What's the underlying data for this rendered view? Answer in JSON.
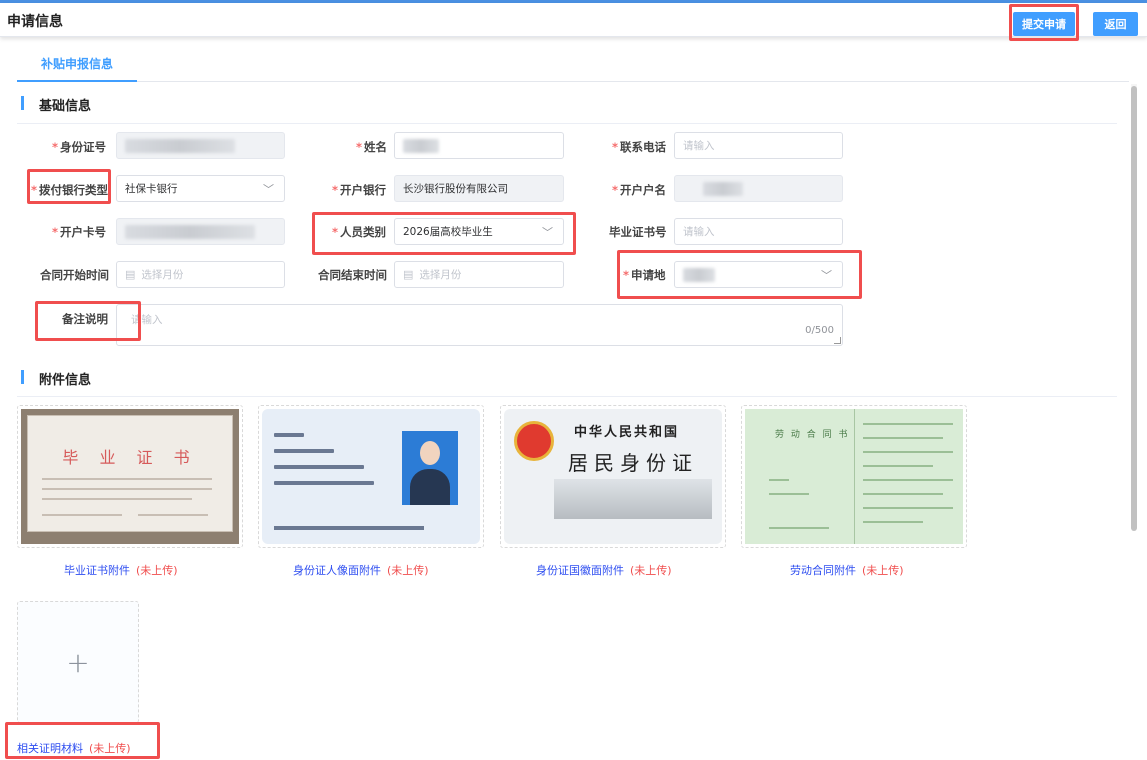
{
  "header": {
    "title": "申请信息",
    "submit_label": "提交申请",
    "back_label": "返回"
  },
  "tabs": [
    {
      "label": "补贴申报信息",
      "active": true
    }
  ],
  "sections": {
    "basic": "基础信息",
    "attachments": "附件信息"
  },
  "form": {
    "id_number": {
      "label": "身份证号",
      "required": true,
      "value": ""
    },
    "name": {
      "label": "姓名",
      "required": true,
      "value": ""
    },
    "phone": {
      "label": "联系电话",
      "required": true,
      "placeholder": "请输入"
    },
    "bank_type": {
      "label": "拨付银行类型",
      "required": true,
      "value": "社保卡银行"
    },
    "open_bank": {
      "label": "开户银行",
      "required": true,
      "value": "长沙银行股份有限公司"
    },
    "account_name": {
      "label": "开户户名",
      "required": true,
      "value": ""
    },
    "card_number": {
      "label": "开户卡号",
      "required": true,
      "value": ""
    },
    "person_type": {
      "label": "人员类别",
      "required": true,
      "value": "2026届高校毕业生"
    },
    "cert_number": {
      "label": "毕业证书号",
      "required": false,
      "placeholder": "请输入"
    },
    "contract_start": {
      "label": "合同开始时间",
      "required": false,
      "placeholder": "选择月份"
    },
    "contract_end": {
      "label": "合同结束时间",
      "required": false,
      "placeholder": "选择月份"
    },
    "apply_place": {
      "label": "申请地",
      "required": true,
      "value": ""
    },
    "remark": {
      "label": "备注说明",
      "required": false,
      "placeholder": "请输入",
      "counter": "0/500"
    }
  },
  "attachments": [
    {
      "label": "毕业证书附件",
      "status": "(未上传)",
      "preview_title": "毕 业 证 书"
    },
    {
      "label": "身份证人像面附件",
      "status": "(未上传)",
      "preview_title": ""
    },
    {
      "label": "身份证国徽面附件",
      "status": "(未上传)",
      "preview_title": "中华人民共和国",
      "preview_subtitle": "居民身份证"
    },
    {
      "label": "劳动合同附件",
      "status": "(未上传)",
      "preview_title": "劳 动 合 同 书"
    }
  ],
  "extra_attachment": {
    "label": "相关证明材料",
    "status": "(未上传)",
    "add_symbol": "+"
  },
  "colors": {
    "primary": "#409eff",
    "required_star": "#f56c6c",
    "highlight": "#f04e4e",
    "caption_link": "#2d4df0"
  }
}
